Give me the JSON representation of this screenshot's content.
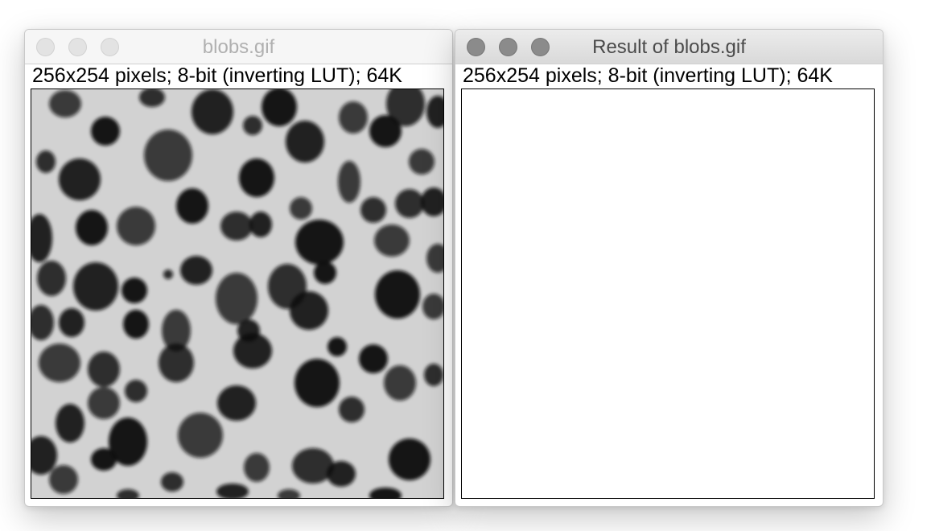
{
  "windows": [
    {
      "title": "blobs.gif",
      "info": "256x254 pixels; 8-bit (inverting LUT); 64K",
      "image": "blobs-micrograph",
      "active": false
    },
    {
      "title": "Result of blobs.gif",
      "info": "256x254 pixels; 8-bit (inverting LUT); 64K",
      "image": "blank-result",
      "active": true
    }
  ],
  "colors": {
    "blob_background": "#d2d2d2",
    "blob_dark": "#111111",
    "result_background": "#ffffff"
  }
}
